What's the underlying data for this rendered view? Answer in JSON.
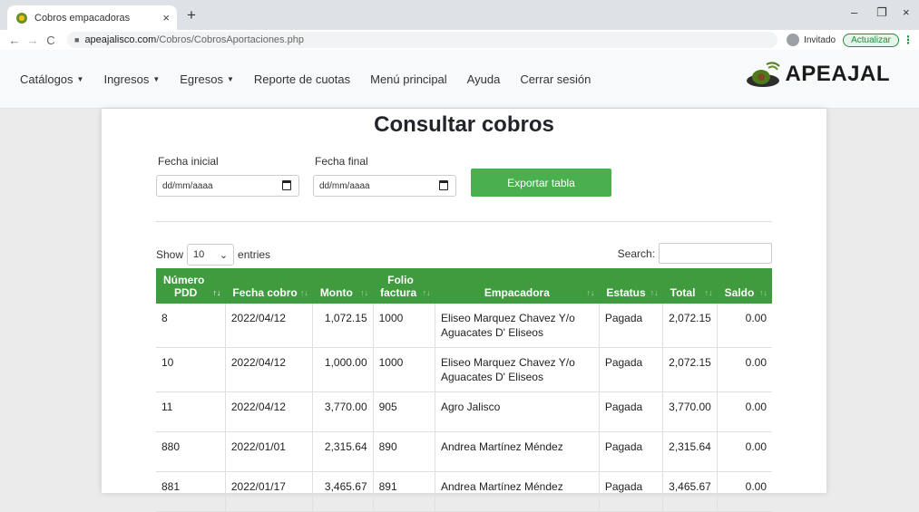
{
  "browser": {
    "tab_title": "Cobros empacadoras",
    "tab_close": "×",
    "new_tab": "+",
    "url_host": "apeajalisco.com",
    "url_path": "/Cobros/CobrosAportaciones.php",
    "profile": "Invitado",
    "update": "Actualizar",
    "win_min": "–",
    "win_max": "❐",
    "win_close": "×"
  },
  "navbar": {
    "items": [
      "Catálogos",
      "Ingresos",
      "Egresos",
      "Reporte de cuotas",
      "Menú principal",
      "Ayuda",
      "Cerrar sesión"
    ],
    "brand_a": "APEA",
    "brand_b": "JAL"
  },
  "page": {
    "title": "Consultar cobros",
    "fecha_inicial_label": "Fecha inicial",
    "fecha_final_label": "Fecha final",
    "date_placeholder": "dd/mm/aaaa",
    "export_label": "Exportar tabla",
    "show_label": "Show",
    "entries_value": "10",
    "entries_label": "entries",
    "search_label": "Search:"
  },
  "table": {
    "headers": [
      {
        "l1": "Número",
        "l2": "PDD"
      },
      {
        "l1": "",
        "l2": "Fecha cobro"
      },
      {
        "l1": "",
        "l2": "Monto"
      },
      {
        "l1": "Folio",
        "l2": "factura"
      },
      {
        "l1": "",
        "l2": "Empacadora"
      },
      {
        "l1": "",
        "l2": "Estatus"
      },
      {
        "l1": "",
        "l2": "Total"
      },
      {
        "l1": "",
        "l2": "Saldo"
      }
    ],
    "rows": [
      [
        "8",
        "2022/04/12",
        "1,072.15",
        "1000",
        "Eliseo Marquez Chavez Y/o Aguacates D' Eliseos",
        "Pagada",
        "2,072.15",
        "0.00"
      ],
      [
        "10",
        "2022/04/12",
        "1,000.00",
        "1000",
        "Eliseo Marquez Chavez Y/o Aguacates D' Eliseos",
        "Pagada",
        "2,072.15",
        "0.00"
      ],
      [
        "11",
        "2022/04/12",
        "3,770.00",
        "905",
        "Agro Jalisco",
        "Pagada",
        "3,770.00",
        "0.00"
      ],
      [
        "880",
        "2022/01/01",
        "2,315.64",
        "890",
        "Andrea Martínez Méndez",
        "Pagada",
        "2,315.64",
        "0.00"
      ],
      [
        "881",
        "2022/01/17",
        "3,465.67",
        "891",
        "Andrea Martínez Méndez",
        "Pagada",
        "3,465.67",
        "0.00"
      ]
    ]
  }
}
